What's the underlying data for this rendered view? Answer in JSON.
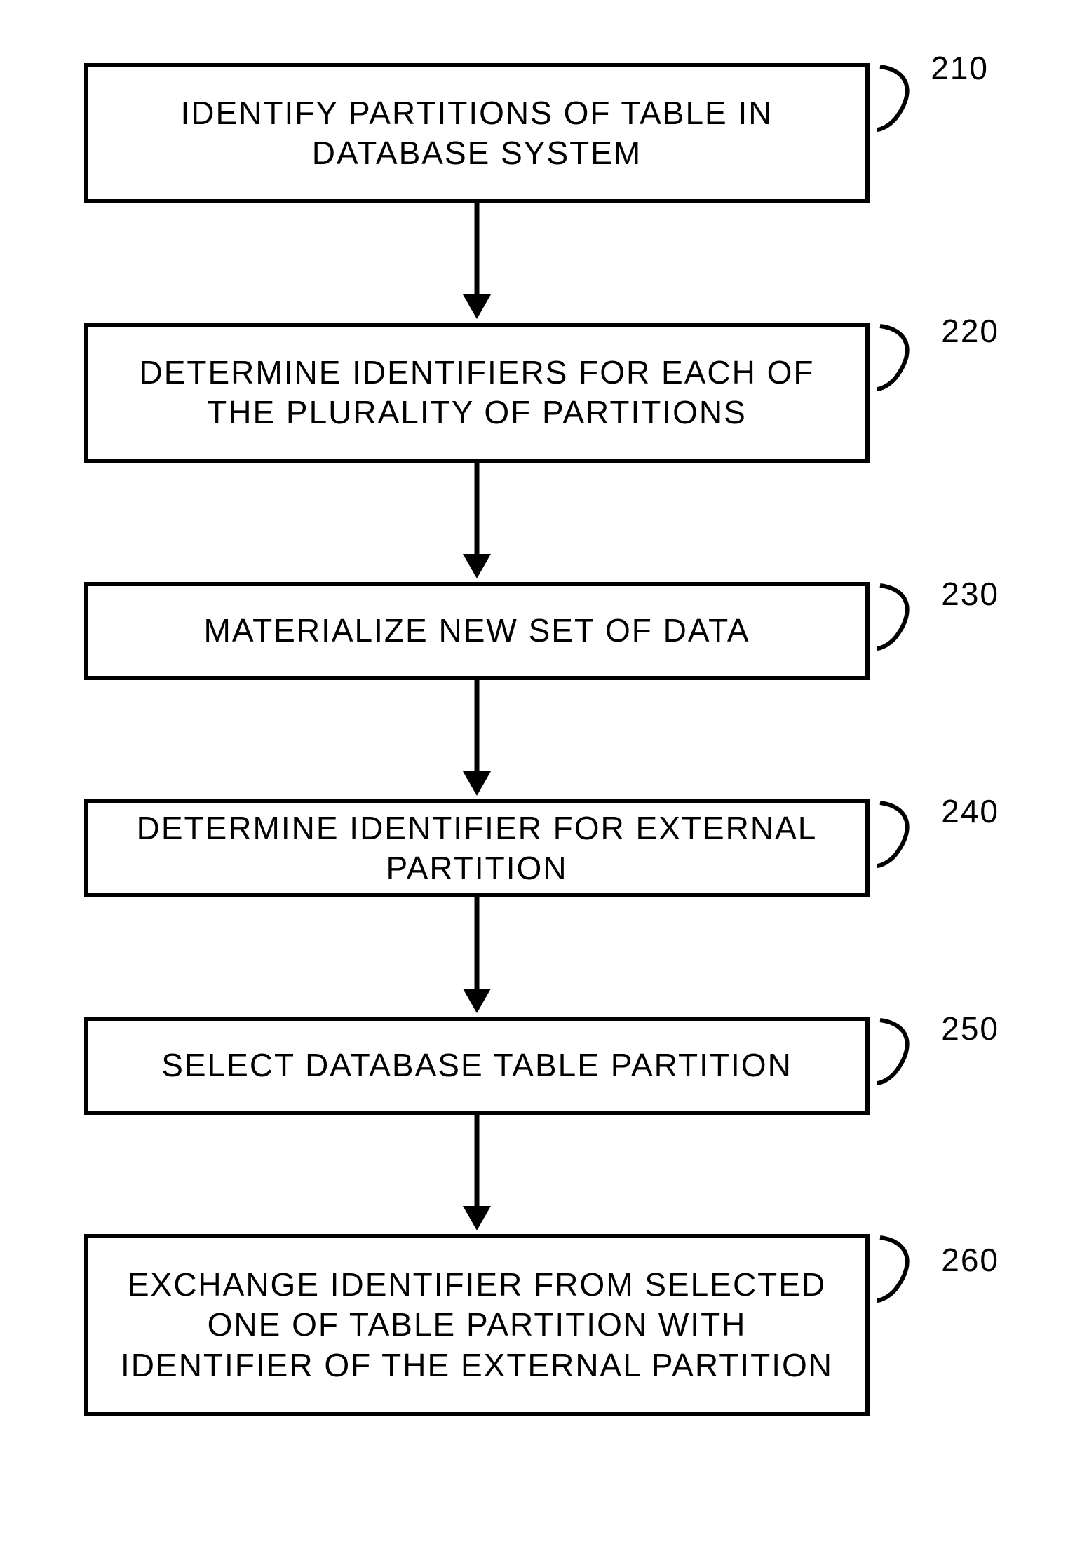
{
  "type": "flowchart",
  "steps": [
    {
      "id": "210",
      "text": "IDENTIFY PARTITIONS OF TABLE IN DATABASE SYSTEM"
    },
    {
      "id": "220",
      "text": "DETERMINE IDENTIFIERS FOR EACH OF THE PLURALITY OF PARTITIONS"
    },
    {
      "id": "230",
      "text": "MATERIALIZE NEW SET OF DATA"
    },
    {
      "id": "240",
      "text": "DETERMINE IDENTIFIER FOR EXTERNAL PARTITION"
    },
    {
      "id": "250",
      "text": "SELECT DATABASE TABLE PARTITION"
    },
    {
      "id": "260",
      "text": "EXCHANGE IDENTIFIER FROM SELECTED ONE OF TABLE PARTITION WITH IDENTIFIER OF THE EXTERNAL PARTITION"
    }
  ],
  "chart_data": {
    "type": "flowchart",
    "nodes": [
      {
        "id": "210",
        "label": "IDENTIFY PARTITIONS OF TABLE IN DATABASE SYSTEM"
      },
      {
        "id": "220",
        "label": "DETERMINE IDENTIFIERS FOR EACH OF THE PLURALITY OF PARTITIONS"
      },
      {
        "id": "230",
        "label": "MATERIALIZE NEW SET OF DATA"
      },
      {
        "id": "240",
        "label": "DETERMINE IDENTIFIER FOR EXTERNAL PARTITION"
      },
      {
        "id": "250",
        "label": "SELECT DATABASE TABLE PARTITION"
      },
      {
        "id": "260",
        "label": "EXCHANGE IDENTIFIER FROM SELECTED ONE OF TABLE PARTITION WITH IDENTIFIER OF THE EXTERNAL PARTITION"
      }
    ],
    "edges": [
      {
        "from": "210",
        "to": "220"
      },
      {
        "from": "220",
        "to": "230"
      },
      {
        "from": "230",
        "to": "240"
      },
      {
        "from": "240",
        "to": "250"
      },
      {
        "from": "250",
        "to": "260"
      }
    ]
  }
}
